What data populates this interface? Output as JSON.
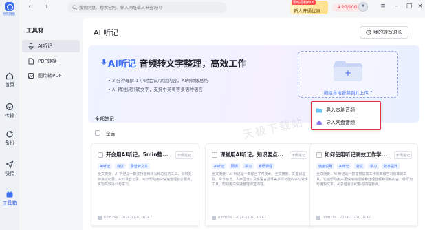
{
  "app": {
    "logo_text": "夸克网盘"
  },
  "nav": [
    {
      "label": "首页",
      "icon": "home-icon"
    },
    {
      "label": "传输",
      "icon": "transfer-icon"
    },
    {
      "label": "备份",
      "icon": "backup-icon"
    },
    {
      "label": "快传",
      "icon": "fast-send-icon"
    },
    {
      "label": "工具箱",
      "icon": "toolbox-icon",
      "active": true
    }
  ],
  "toolbox": {
    "title": "工具箱",
    "items": [
      {
        "label": "AI听记",
        "icon": "ai-listen-icon",
        "active": true
      },
      {
        "label": "PDF转换",
        "icon": "pdf-icon"
      },
      {
        "label": "图片转PDF",
        "icon": "image-pdf-icon"
      }
    ]
  },
  "topbar": {
    "search_placeholder": "搜索网盘、搜索全网、输入网址或从书签访问",
    "promo_tag": "限时福利¥9.6",
    "promo_text": "新人开通优惠",
    "quota": "4.2G/10G"
  },
  "main": {
    "title": "AI 听记",
    "duration_button": "我的转写时长",
    "hero": {
      "headline_ai": "AI听记",
      "headline_rest": " 音频转文字整理，高效工作",
      "bullet1": "• 3 分钟理解 1 小时会议/课堂内容，AI帮你做总结",
      "bullet2": "• AI 精准识别转文字，支持中英粤等多语种语言",
      "drop_label": "拖拽本地音频到此上传 ⌃"
    },
    "upload_menu": [
      {
        "label": "导入本地音频",
        "icon": "local-audio-icon"
      },
      {
        "label": "导入网盘音频",
        "icon": "cloud-audio-icon"
      }
    ],
    "notes_title": "全部笔记",
    "select_all": "全选",
    "watermark": "天极下载站",
    "cards": [
      {
        "title": "开会用AI听记，5min整...",
        "status": "示例笔记",
        "tags": [
          "AI听记",
          "会议",
          "录音转文本"
        ],
        "body": "全文摘要：AI 听记是一款支持音频转写和总结的工具，同时支持会议纪要、实时录音记录，可以帮助用户快速整理会议要点，实现高效办公与学习。",
        "meta": "02m29s · 2024-11-01 10:47"
      },
      {
        "title": "课堂用AI听记，知识要点...",
        "status": "示例笔记",
        "tags": [
          "AI听记",
          "网课",
          "学习",
          "考研课程"
        ],
        "body": "全文摘要：AI 听记是一款综合了AI技术、全文摘要、关键词提取、章节速览、人声区分以及多语言翻译等多项功能的学习效率工具，帮助用户快速整理课堂内容。",
        "meta": "03m11s · 2024-11-01 10:47"
      },
      {
        "title": "如何使用听记高效工作学...",
        "status": "示例笔记",
        "tags": [
          "使用说明",
          "AI听记",
          "会议",
          "学习",
          "效率提升"
        ],
        "body": "全文摘要：AI 听记是一款能够提高工作效率和学习效率的工具，它能帮助用户更快速地理解和处理音频和视频内容，转写为可编辑文本，AI总结会议纪要与内容要点。",
        "meta": "03m19s · 2024-11-01 10:47"
      }
    ]
  }
}
